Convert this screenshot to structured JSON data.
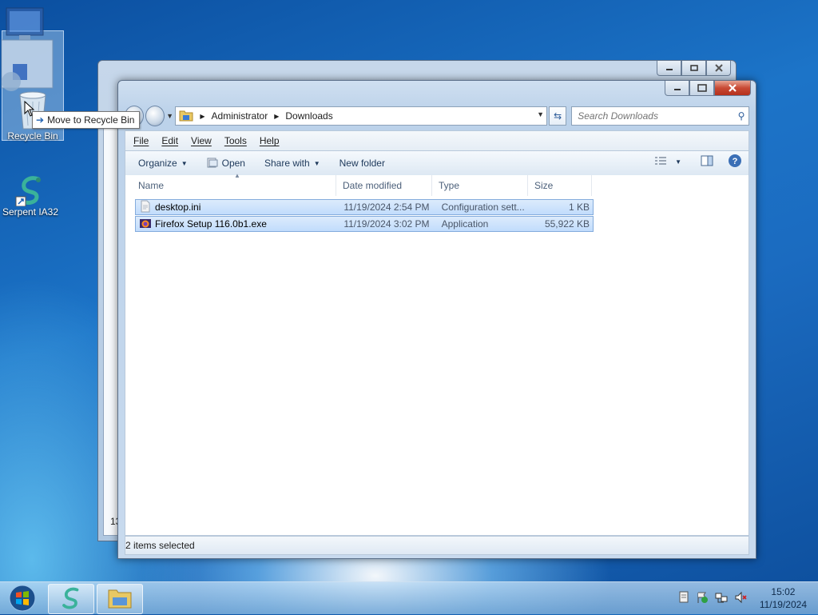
{
  "desktop": {
    "icons": [
      {
        "label": "Recycle Bin"
      },
      {
        "label": "Serpent IA32"
      }
    ],
    "drag_tooltip": "Move to Recycle Bin"
  },
  "back_window": {
    "status_fragment": "13"
  },
  "explorer": {
    "breadcrumb": [
      "Administrator",
      "Downloads"
    ],
    "search_placeholder": "Search Downloads",
    "menu": [
      "File",
      "Edit",
      "View",
      "Tools",
      "Help"
    ],
    "toolbar": {
      "organize": "Organize",
      "open": "Open",
      "share_with": "Share with",
      "new_folder": "New folder"
    },
    "columns": [
      "Name",
      "Date modified",
      "Type",
      "Size"
    ],
    "files": [
      {
        "name": "desktop.ini",
        "date": "11/19/2024 2:54 PM",
        "type": "Configuration sett...",
        "size": "1 KB",
        "icon": "config-file-icon"
      },
      {
        "name": "Firefox Setup 116.0b1.exe",
        "date": "11/19/2024 3:02 PM",
        "type": "Application",
        "size": "55,922 KB",
        "icon": "firefox-installer-icon"
      }
    ],
    "status": "2 items selected"
  },
  "taskbar": {
    "time": "15:02",
    "date": "11/19/2024"
  }
}
